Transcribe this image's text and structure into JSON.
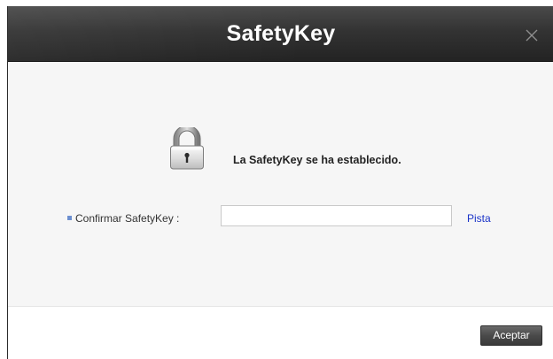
{
  "dialog": {
    "title": "SafetyKey",
    "close_icon": "close-icon",
    "message": "La SafetyKey se ha establecido.",
    "lock_icon": "padlock-icon",
    "field": {
      "label": "Confirmar SafetyKey :",
      "value": "",
      "placeholder": ""
    },
    "hint_link": "Pista",
    "ok_button": "Aceptar"
  },
  "colors": {
    "titlebar": "#333333",
    "title_text": "#ffffff",
    "content_bg": "#f6f6f6",
    "link": "#1a33c8",
    "bullet": "#6c8fd0",
    "button": "#4a4a4a"
  }
}
